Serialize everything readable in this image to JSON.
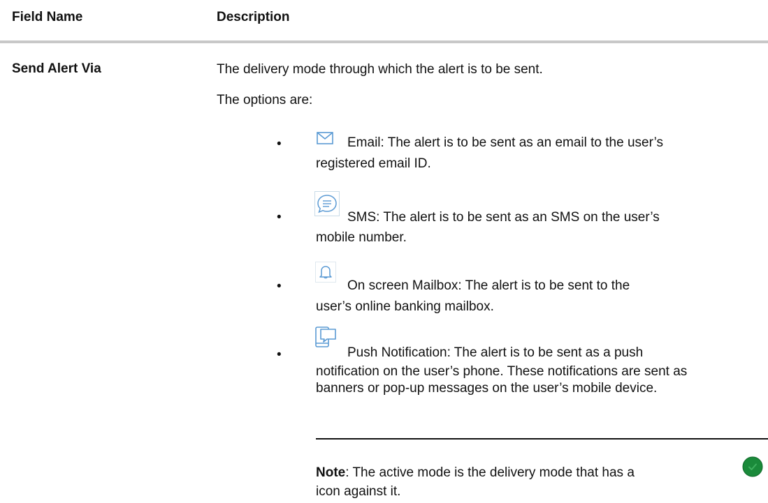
{
  "table": {
    "header_field": "Field Name",
    "header_description": "Description"
  },
  "row": {
    "field": "Send Alert Via",
    "intro": "The delivery mode through which the alert is to be sent.",
    "options_label": "The options are:",
    "options": [
      {
        "icon": "envelope-icon",
        "text_first": "Email: The alert is to be sent as an email to the user’s",
        "text_rest": "registered email ID."
      },
      {
        "icon": "chat-bubble-icon",
        "text_first": "SMS: The alert is to be sent as an SMS on the user’s",
        "text_rest": "mobile number."
      },
      {
        "icon": "bell-icon",
        "text_first": "On screen Mailbox: The alert is to be sent to the",
        "text_rest": "user’s online banking mailbox."
      },
      {
        "icon": "push-notification-icon",
        "text_first": "Push Notification: The alert is to be sent as a push",
        "text_rest": "notification on the user’s phone. These notifications are sent as banners or pop-up messages on the user’s mobile device."
      }
    ],
    "note_label": "Note",
    "note_text": ": The active mode is the delivery mode that has a",
    "note_text_end": "icon against it."
  },
  "colors": {
    "icon_blue": "#5a9ad4",
    "check_green": "#1a8a3a",
    "rule_gray": "#c8c8c8"
  }
}
